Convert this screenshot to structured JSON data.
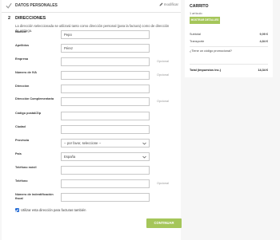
{
  "step1": {
    "title": "DATOS PERSONALES",
    "edit_label": "modificar",
    "check_color": "#9e9e9e"
  },
  "step2": {
    "number": "2",
    "title": "DIRECCIONES",
    "intro": "La dirección seleccionada se utilizará tanto como dirección personal (para la factura) como de dirección de entrega."
  },
  "form": {
    "optional_label": "Opcional",
    "fields": [
      {
        "label": "Nombre",
        "value": "Pepo"
      },
      {
        "label": "Apellidos",
        "value": "Pérez"
      },
      {
        "label": "Empresa",
        "value": "",
        "optional": true
      },
      {
        "label": "Número de IVA",
        "value": "",
        "optional": true
      },
      {
        "label": "Dirección",
        "value": ""
      },
      {
        "label": "Dirección Complementaria",
        "value": "",
        "optional": true
      },
      {
        "label": "Código postal/Zip",
        "value": ""
      },
      {
        "label": "Ciudad",
        "value": ""
      },
      {
        "label": "Provincia",
        "value": "-- por favor, seleccione --"
      },
      {
        "label": "País",
        "value": "España"
      },
      {
        "label": "Teléfono móvil",
        "value": ""
      },
      {
        "label": "Teléfono",
        "value": "",
        "optional": true
      },
      {
        "label": "Número de indentificación fiscal",
        "value": ""
      }
    ],
    "checkbox_label": "Utilizar esta dirección para facturas también",
    "checkbox_checked": true,
    "continue_label": "CONTINUAR"
  },
  "cart": {
    "title": "CARRITO",
    "item_count": "1 artículo",
    "show_details_label": "MOSTRAR DETALLES",
    "subtotal_label": "Subtotal",
    "subtotal_value": "9,99 €",
    "shipping_label": "Transporte",
    "shipping_value": "4,84 €",
    "promo_label": "¿Tiene un código promocional?",
    "total_label": "Total (impuestos inc.)",
    "total_value": "14,34 €"
  },
  "colors": {
    "accent_green": "#a5c65a",
    "checkbox_blue": "#2a6fd6"
  }
}
